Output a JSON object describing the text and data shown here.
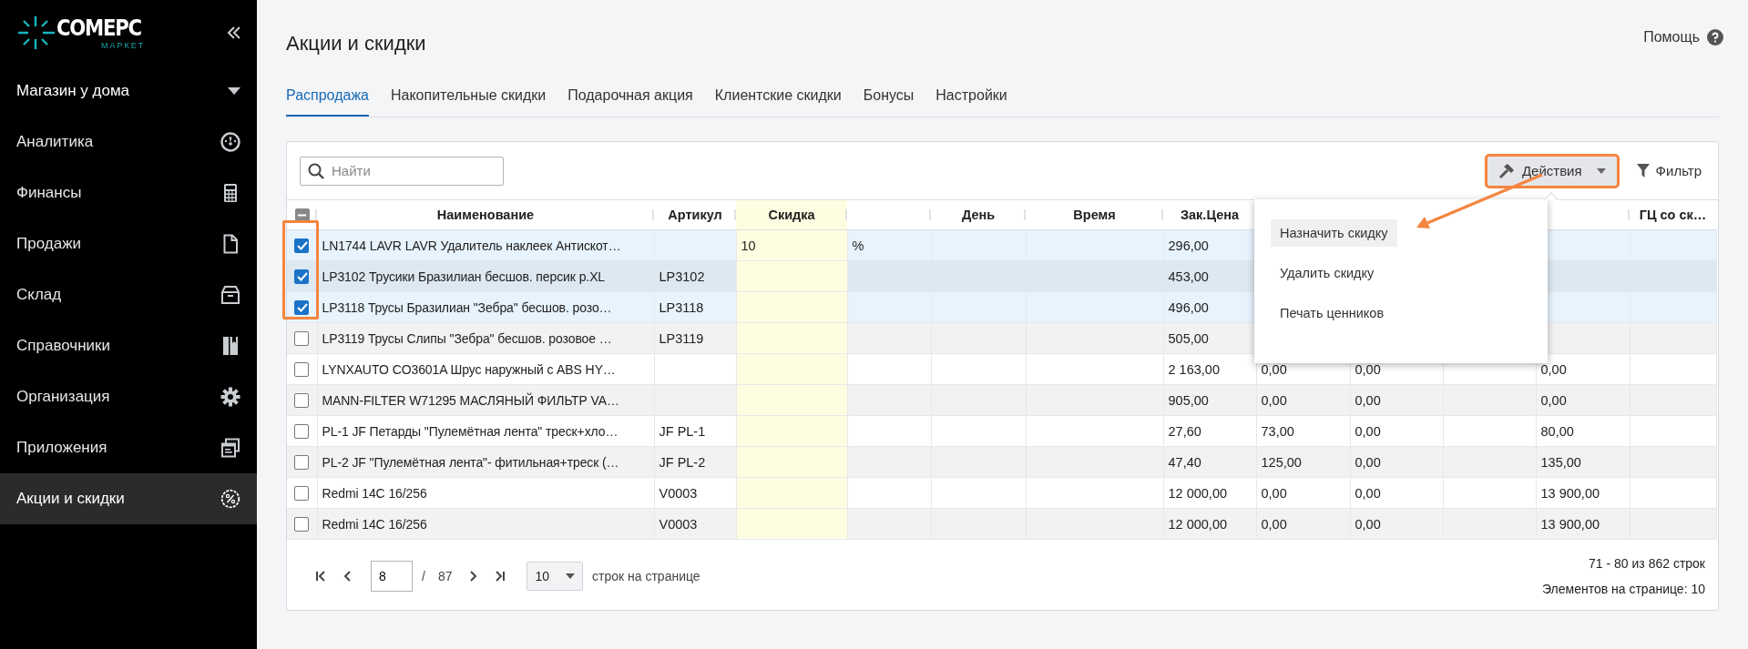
{
  "sidebar": {
    "logo": {
      "name": "COMEPC",
      "subtitle": "МАРКЕТ"
    },
    "store": "Магазин у дома",
    "items": [
      {
        "label": "Аналитика",
        "kind": "gauge",
        "selected": false
      },
      {
        "label": "Финансы",
        "kind": "calculator",
        "selected": false
      },
      {
        "label": "Продажи",
        "kind": "document",
        "selected": false
      },
      {
        "label": "Склад",
        "kind": "box",
        "selected": false
      },
      {
        "label": "Справочники",
        "kind": "book",
        "selected": false
      },
      {
        "label": "Организация",
        "kind": "gear",
        "selected": false
      },
      {
        "label": "Приложения",
        "kind": "windows",
        "selected": false
      },
      {
        "label": "Акции и скидки",
        "kind": "percent",
        "selected": true
      }
    ]
  },
  "header": {
    "title": "Акции и скидки",
    "help": "Помощь"
  },
  "tabs": [
    {
      "label": "Распродажа",
      "selected": true
    },
    {
      "label": "Накопительные скидки",
      "selected": false
    },
    {
      "label": "Подарочная акция",
      "selected": false
    },
    {
      "label": "Клиентские скидки",
      "selected": false
    },
    {
      "label": "Бонусы",
      "selected": false
    },
    {
      "label": "Настройки",
      "selected": false
    }
  ],
  "toolbar": {
    "search_placeholder": "Найти",
    "actions": "Действия",
    "filter": "Фильтр"
  },
  "table": {
    "header_check": {
      "indeterminate": true
    },
    "columns": [
      {
        "label": "Наименование",
        "highlight": false
      },
      {
        "label": "Артикул",
        "highlight": false
      },
      {
        "label": "Скидка",
        "highlight": true
      },
      {
        "highlight": false
      },
      {
        "label": "День",
        "highlight": false
      },
      {
        "label": "Время",
        "highlight": false
      },
      {
        "label": "Зак.Цена",
        "highlight": false
      },
      {},
      {},
      {},
      {
        "highlight": false
      },
      {
        "label": "ГЦ со ск…",
        "highlight": false
      }
    ],
    "rows": [
      {
        "checked": true,
        "selected": true,
        "cells": [
          "LN1744 LAVR LAVR Удалитель наклеек Антискот…",
          null,
          "10",
          "%",
          null,
          null,
          "296,00",
          null,
          null,
          null,
          null,
          null
        ]
      },
      {
        "checked": true,
        "selected": true,
        "cells": [
          "LP3102 Трусики Бразилиан бесшов. персик р.XL",
          "LP3102",
          null,
          null,
          null,
          null,
          "453,00",
          null,
          null,
          null,
          null,
          null
        ]
      },
      {
        "checked": true,
        "selected": true,
        "cells": [
          "LP3118 Трусы Бразилиан \"Зебра\" бесшов. розо…",
          "LP3118",
          null,
          null,
          null,
          null,
          "496,00",
          null,
          null,
          null,
          null,
          null
        ]
      },
      {
        "checked": false,
        "selected": false,
        "cells": [
          "LP3119 Трусы Слипы \"Зебра\" бесшов. розовое …",
          "LP3119",
          null,
          null,
          null,
          null,
          "505,00",
          null,
          null,
          null,
          null,
          null
        ]
      },
      {
        "checked": false,
        "selected": false,
        "cells": [
          "LYNXAUTO CO3601A Шрус наружный с ABS HY…",
          null,
          null,
          null,
          null,
          null,
          "2 163,00",
          "0,00",
          "0,00",
          null,
          "0,00",
          null
        ]
      },
      {
        "checked": false,
        "selected": false,
        "cells": [
          "MANN-FILTER W71295 МАСЛЯНЫЙ ФИЛЬТР VA…",
          null,
          null,
          null,
          null,
          null,
          "905,00",
          "0,00",
          "0,00",
          null,
          "0,00",
          null
        ]
      },
      {
        "checked": false,
        "selected": false,
        "cells": [
          "PL-1 JF Петарды \"Пулемётная лента\" треск+хло…",
          "JF PL-1",
          null,
          null,
          null,
          null,
          "27,60",
          "73,00",
          "0,00",
          null,
          "80,00",
          null
        ]
      },
      {
        "checked": false,
        "selected": false,
        "cells": [
          "PL-2 JF \"Пулемётная лента\"- фитильная+треск (…",
          "JF PL-2",
          null,
          null,
          null,
          null,
          "47,40",
          "125,00",
          "0,00",
          null,
          "135,00",
          null
        ]
      },
      {
        "checked": false,
        "selected": false,
        "cells": [
          "Redmi 14C 16/256",
          "V0003",
          null,
          null,
          null,
          null,
          "12 000,00",
          "0,00",
          "0,00",
          null,
          "13 900,00",
          null
        ]
      },
      {
        "checked": false,
        "selected": false,
        "cells": [
          "Redmi 14C 16/256",
          "V0003",
          null,
          null,
          null,
          null,
          "12 000,00",
          "0,00",
          "0,00",
          null,
          "13 900,00",
          null
        ]
      }
    ]
  },
  "actions_menu": {
    "items": [
      {
        "label": "Назначить скидку",
        "selected": true
      },
      {
        "label": "Удалить скидку",
        "selected": false
      },
      {
        "label": "Печать ценников",
        "selected": false
      }
    ]
  },
  "pagination": {
    "page": "8",
    "separator": "/",
    "total_pages": "87",
    "page_size": "10",
    "page_size_label": "строк на странице",
    "range": "71 - 80 из 862 строк",
    "per_page": "Элементов на странице: 10"
  }
}
